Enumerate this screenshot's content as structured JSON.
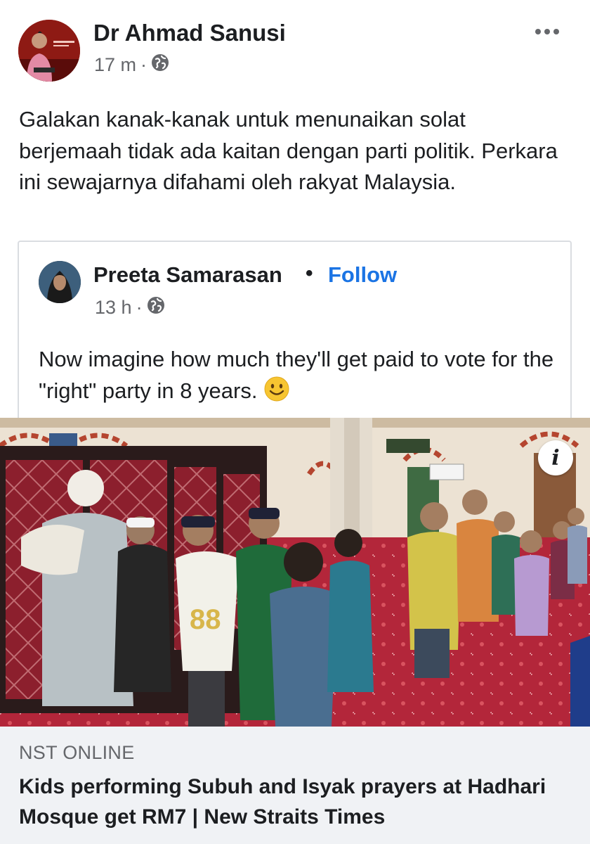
{
  "post": {
    "author": "Dr Ahmad Sanusi",
    "time": "17 m",
    "separator": "·",
    "text": "Galakan kanak-kanak untuk menunaikan solat berjemaah tidak ada kaitan dengan parti politik. Perkara ini sewajarnya difahami oleh rakyat Malaysia.",
    "icons": {
      "more": "more-options-icon",
      "audience": "globe-icon"
    }
  },
  "shared_post": {
    "author": "Preeta Samarasan",
    "dot": "•",
    "follow_label": "Follow",
    "time": "13 h",
    "separator": "·",
    "text": "Now imagine how much they'll get paid to vote for the \"right\" party in 8 years.",
    "emoji": "smiling-face-emoji"
  },
  "link_preview": {
    "source": "NST ONLINE",
    "title": "Kids performing Subuh and Isyak prayers at Hadhari Mosque get RM7 | New Straits Times",
    "info_icon": "info-icon",
    "info_label": "i"
  },
  "colors": {
    "text": "#1c1e21",
    "secondary": "#65676b",
    "follow": "#1b74e4",
    "link_bg": "#f0f2f5",
    "border": "#dadde1"
  }
}
